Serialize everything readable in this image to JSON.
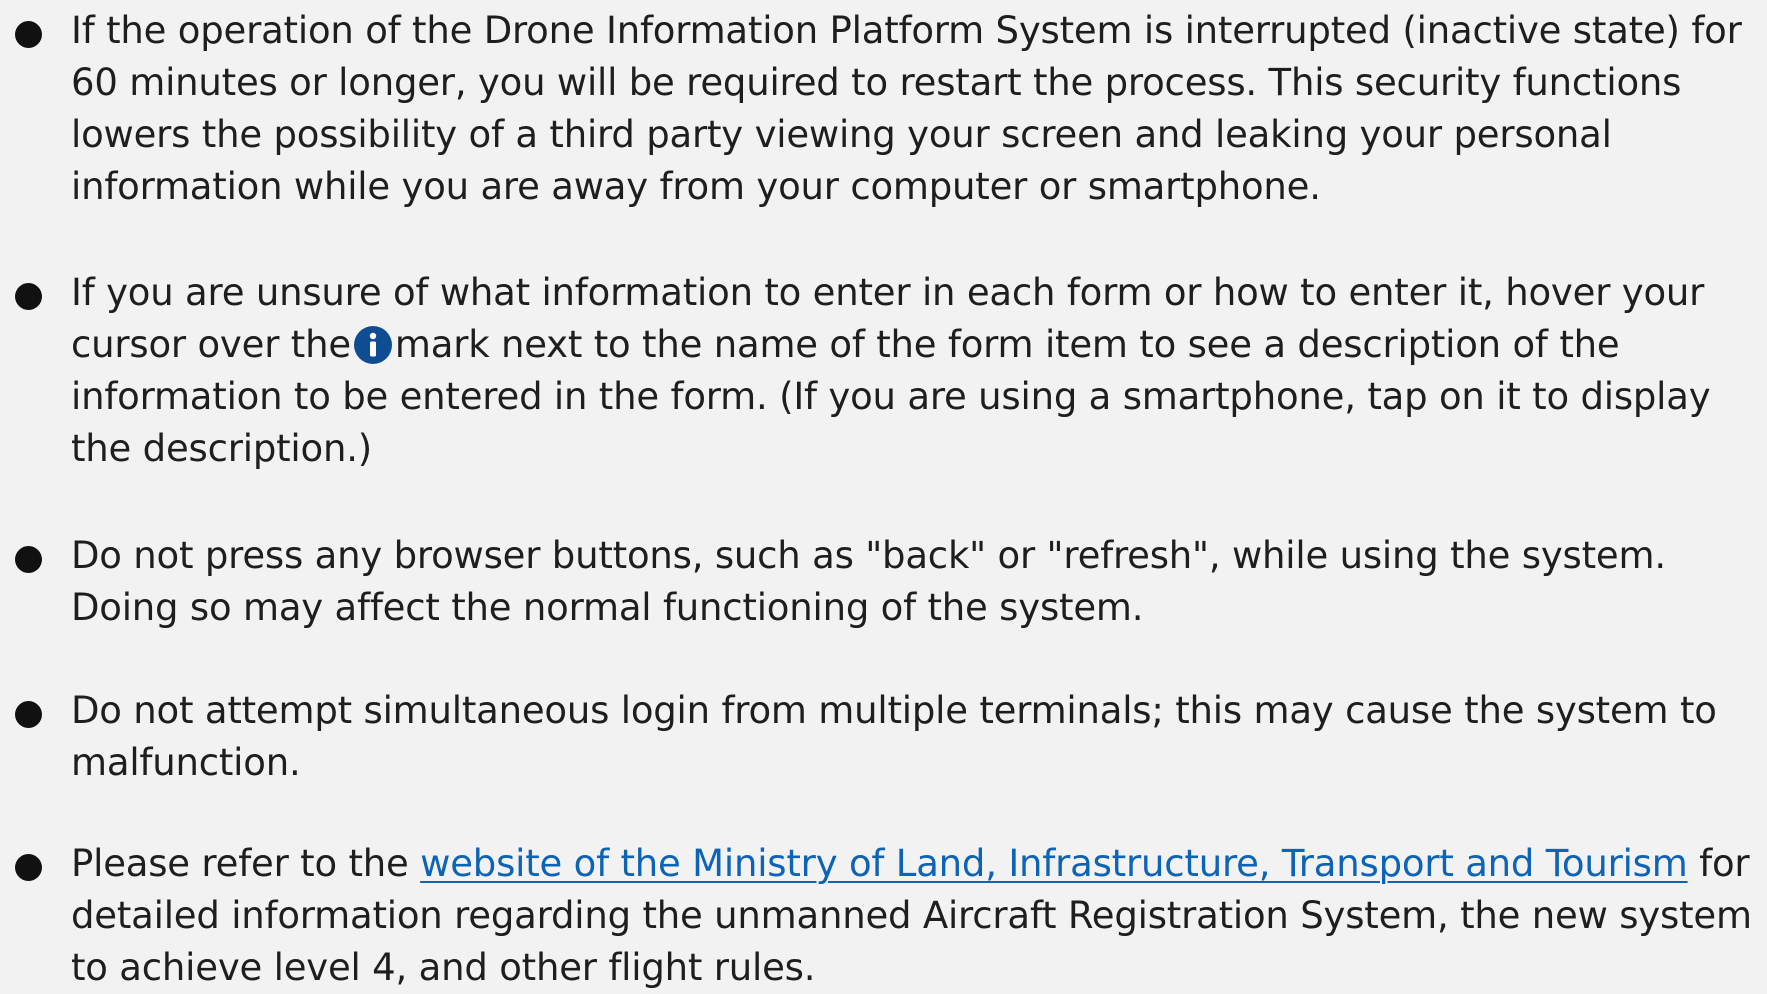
{
  "notices": [
    {
      "text": " If the operation of the Drone Information Platform System is interrupted (inactive state) for 60 minutes or longer, you will be required to restart the process. This security functions lowers the possibility of a third party viewing your screen and leaking your personal information while you are away from your computer or smartphone."
    },
    {
      "text_before_icon": " If you are unsure of what information to enter in each form or how to enter it, hover your cursor over the",
      "icon": "info-icon",
      "text_after_icon": "mark next to the name of the form item to see a description of the information to be entered in the form. (If you are using a smartphone, tap on it to display the description.)"
    },
    {
      "text": " Do not press any browser buttons, such as \"back\" or \"refresh\", while using the system. Doing so may affect the normal functioning of the system."
    },
    {
      "text": "Do not attempt simultaneous login from multiple terminals; this may cause the system to malfunction."
    },
    {
      "text_before_link": "Please refer to the ",
      "link_text": "website of the Ministry of Land, Infrastructure, Transport and Tourism",
      "text_after_link": " for detailed information regarding the unmanned Aircraft Registration System, the new system to achieve level 4, and other flight rules."
    }
  ],
  "colors": {
    "background": "#f2f2f2",
    "text": "#1e1e1e",
    "link": "#0d63b5",
    "info_icon": "#0f4d92"
  }
}
